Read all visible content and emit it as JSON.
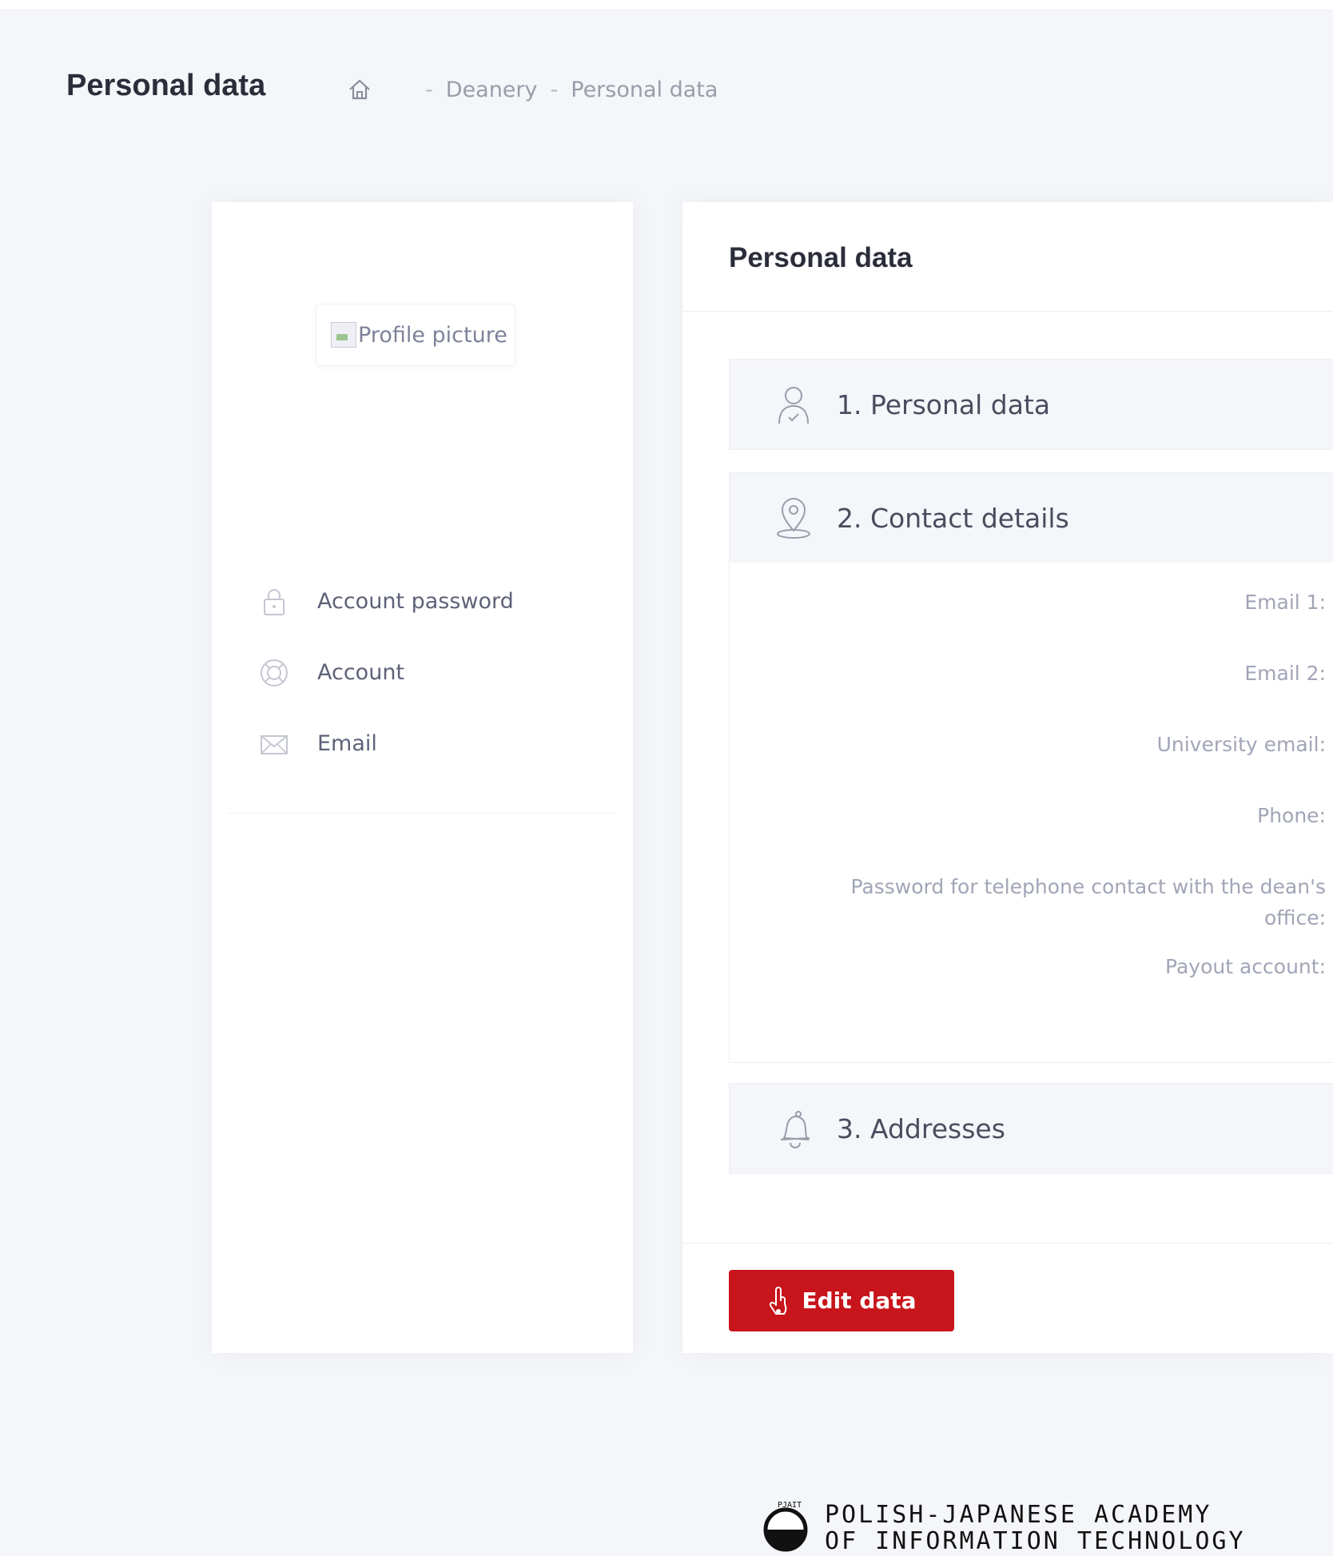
{
  "header": {
    "title": "Personal data",
    "breadcrumb": {
      "items": [
        "Deanery",
        "Personal data"
      ],
      "separator": "-"
    }
  },
  "profile": {
    "picture_alt": "Profile picture"
  },
  "menu": {
    "items": [
      {
        "label": "Account password",
        "icon": "lock-icon"
      },
      {
        "label": "Account",
        "icon": "lifebuoy-icon"
      },
      {
        "label": "Email",
        "icon": "envelope-icon"
      }
    ]
  },
  "panel": {
    "title": "Personal data",
    "sections": [
      {
        "label": "1. Personal data",
        "icon": "user-icon"
      },
      {
        "label": "2. Contact details",
        "icon": "location-pin-icon"
      },
      {
        "label": "3. Addresses",
        "icon": "bell-icon"
      }
    ],
    "contact_fields": [
      "Email 1:",
      "Email 2:",
      "University email:",
      "Phone:",
      "Password for telephone contact with the dean's office:",
      "Payout account:"
    ],
    "edit_button": "Edit data"
  },
  "footer": {
    "logo_line1": "POLISH-JAPANESE ACADEMY",
    "logo_line2": "OF INFORMATION TECHNOLOGY"
  },
  "colors": {
    "accent": "#c8141b",
    "background": "#f4f6f9"
  }
}
